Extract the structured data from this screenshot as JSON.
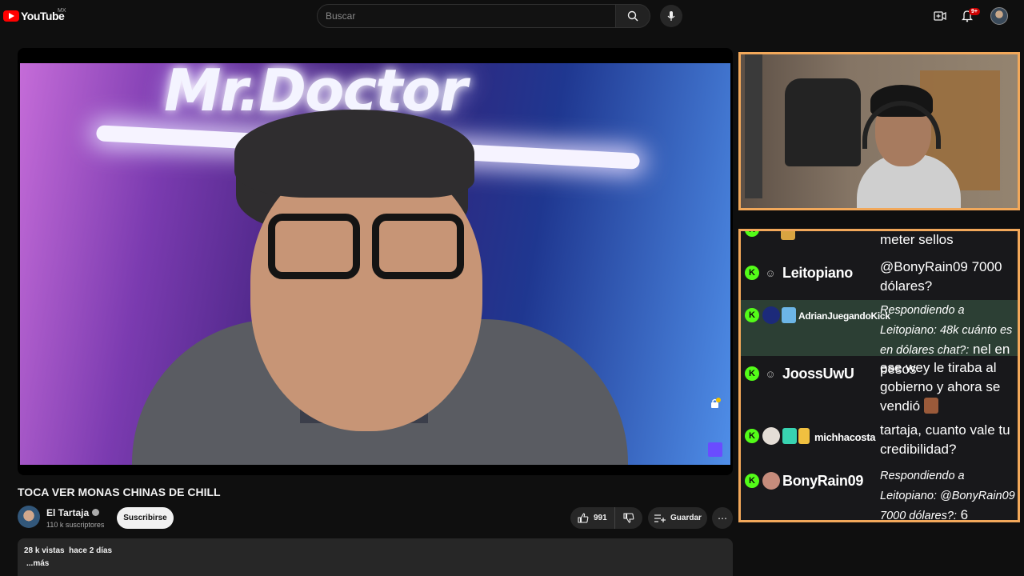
{
  "header": {
    "logo_text": "YouTube",
    "region": "MX",
    "search_placeholder": "Buscar",
    "notifications_badge": "9+"
  },
  "video": {
    "overlay_sign_text": "Mr.Doctor",
    "title": "TOCA VER MONAS CHINAS DE CHILL",
    "channel": {
      "name": "El Tartaja",
      "subscribers": "110 k suscriptores",
      "subscribe_label": "Suscribirse"
    },
    "actions": {
      "likes": "991",
      "save_label": "Guardar",
      "more_label": "⋯"
    },
    "description": {
      "views": "28 k vistas",
      "age": "hace 2 días",
      "more_label": "...más"
    }
  },
  "chat": {
    "messages": [
      {
        "user": "",
        "text": "meter sellos"
      },
      {
        "user": "Leitopiano",
        "text": "@BonyRain09 7000 dólares?"
      },
      {
        "user": "AdrianJuegandoKick",
        "reply": "Respondiendo a Leitopiano: 48k cuánto es en dólares chat?:",
        "text": "nel en pesos"
      },
      {
        "user": "JoossUwU",
        "text": "ese wey le tiraba al gobierno y ahora se vendió"
      },
      {
        "user": "michhacosta",
        "text": "tartaja, cuanto vale tu credibilidad?"
      },
      {
        "user": "BonyRain09",
        "reply": "Respondiendo a Leitopiano: @BonyRain09 7000 dólares?:",
        "text": "6"
      }
    ]
  },
  "colors": {
    "accent_orange": "#f2a85a",
    "kick_green": "#53fc18",
    "youtube_red": "#ff0000"
  }
}
